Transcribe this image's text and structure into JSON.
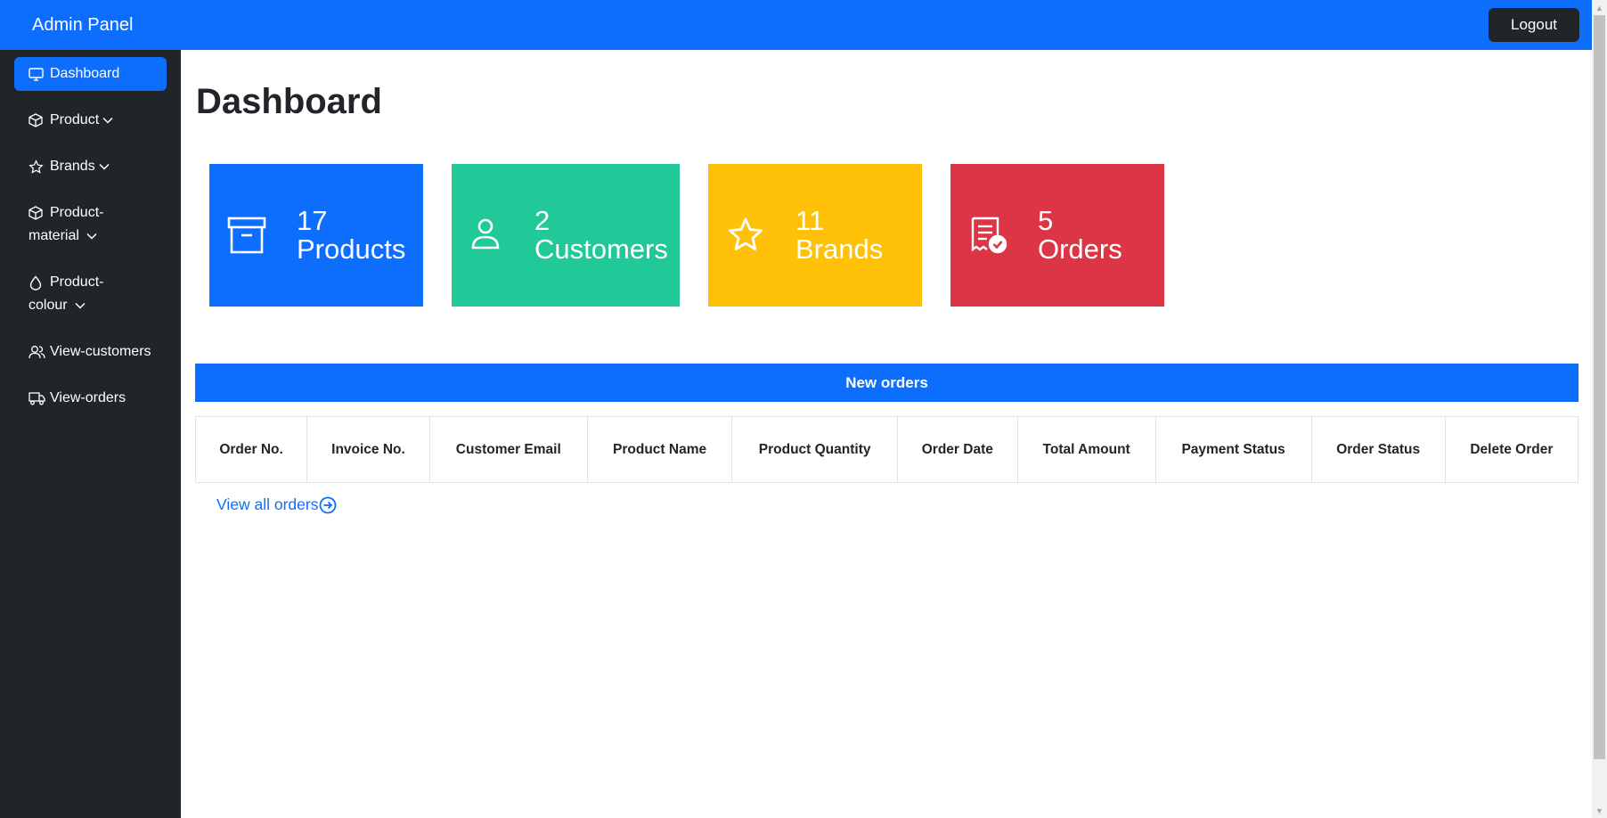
{
  "header": {
    "brand": "Admin Panel",
    "logout_label": "Logout"
  },
  "sidebar": {
    "items": [
      {
        "label": "Dashboard",
        "icon": "monitor-icon",
        "active": true
      },
      {
        "label": "Product",
        "icon": "box-icon",
        "has_dropdown": true
      },
      {
        "label": "Brands",
        "icon": "star-icon",
        "has_dropdown": true
      },
      {
        "label_line1": "Product-",
        "label_line2": "material",
        "icon": "box-icon",
        "has_dropdown": true
      },
      {
        "label_line1": "Product-",
        "label_line2": "colour",
        "icon": "droplet-icon",
        "has_dropdown": true
      },
      {
        "label": "View-customers",
        "icon": "people-icon"
      },
      {
        "label": "View-orders",
        "icon": "truck-icon"
      }
    ]
  },
  "main": {
    "title": "Dashboard",
    "stats": [
      {
        "count": "17",
        "label": "Products",
        "icon": "archive-icon",
        "color": "#0d6efd"
      },
      {
        "count": "2",
        "label": "Customers",
        "icon": "person-icon",
        "color": "#20c997"
      },
      {
        "count": "11",
        "label": "Brands",
        "icon": "star-icon",
        "color": "#ffc107"
      },
      {
        "count": "5",
        "label": "Orders",
        "icon": "receipt-check-icon",
        "color": "#dc3545"
      }
    ],
    "new_orders_title": "New orders",
    "table_headers": [
      "Order No.",
      "Invoice No.",
      "Customer Email",
      "Product Name",
      "Product Quantity",
      "Order Date",
      "Total Amount",
      "Payment Status",
      "Order Status",
      "Delete Order"
    ],
    "view_all_label": "View all orders"
  }
}
